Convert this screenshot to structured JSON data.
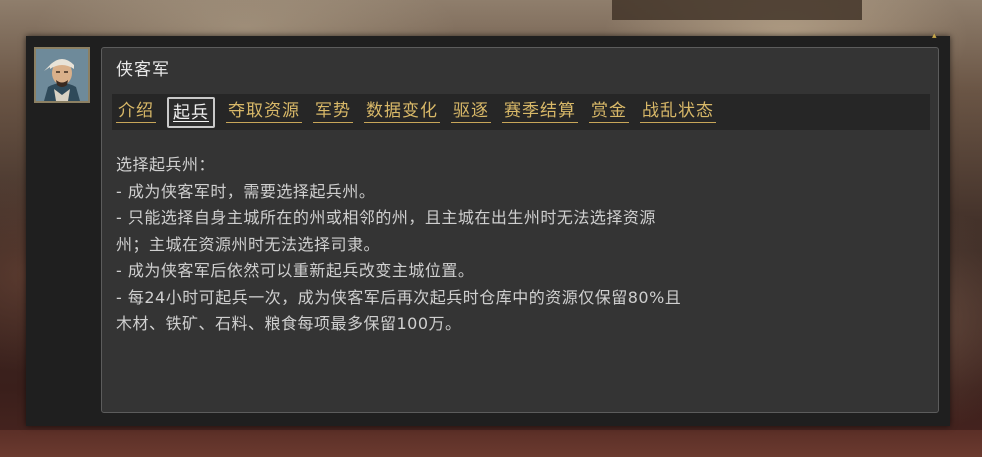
{
  "dialog": {
    "title": "侠客军",
    "portrait_icon": "general-portrait",
    "accent_color": "#d8b868",
    "tabs": [
      {
        "label": "介绍",
        "active": false
      },
      {
        "label": "起兵",
        "active": true
      },
      {
        "label": "夺取资源",
        "active": false
      },
      {
        "label": "军势",
        "active": false
      },
      {
        "label": "数据变化",
        "active": false
      },
      {
        "label": "驱逐",
        "active": false
      },
      {
        "label": "赛季结算",
        "active": false
      },
      {
        "label": "赏金",
        "active": false
      },
      {
        "label": "战乱状态",
        "active": false
      }
    ],
    "content": {
      "lines": [
        "选择起兵州：",
        "- 成为侠客军时，需要选择起兵州。",
        "- 只能选择自身主城所在的州或相邻的州，且主城在出生州时无法选择资源",
        "州；主城在资源州时无法选择司隶。",
        "- 成为侠客军后依然可以重新起兵改变主城位置。",
        "- 每24小时可起兵一次，成为侠客军后再次起兵时仓库中的资源仅保留80%且",
        "木材、铁矿、石料、粮食每项最多保留100万。"
      ]
    }
  }
}
